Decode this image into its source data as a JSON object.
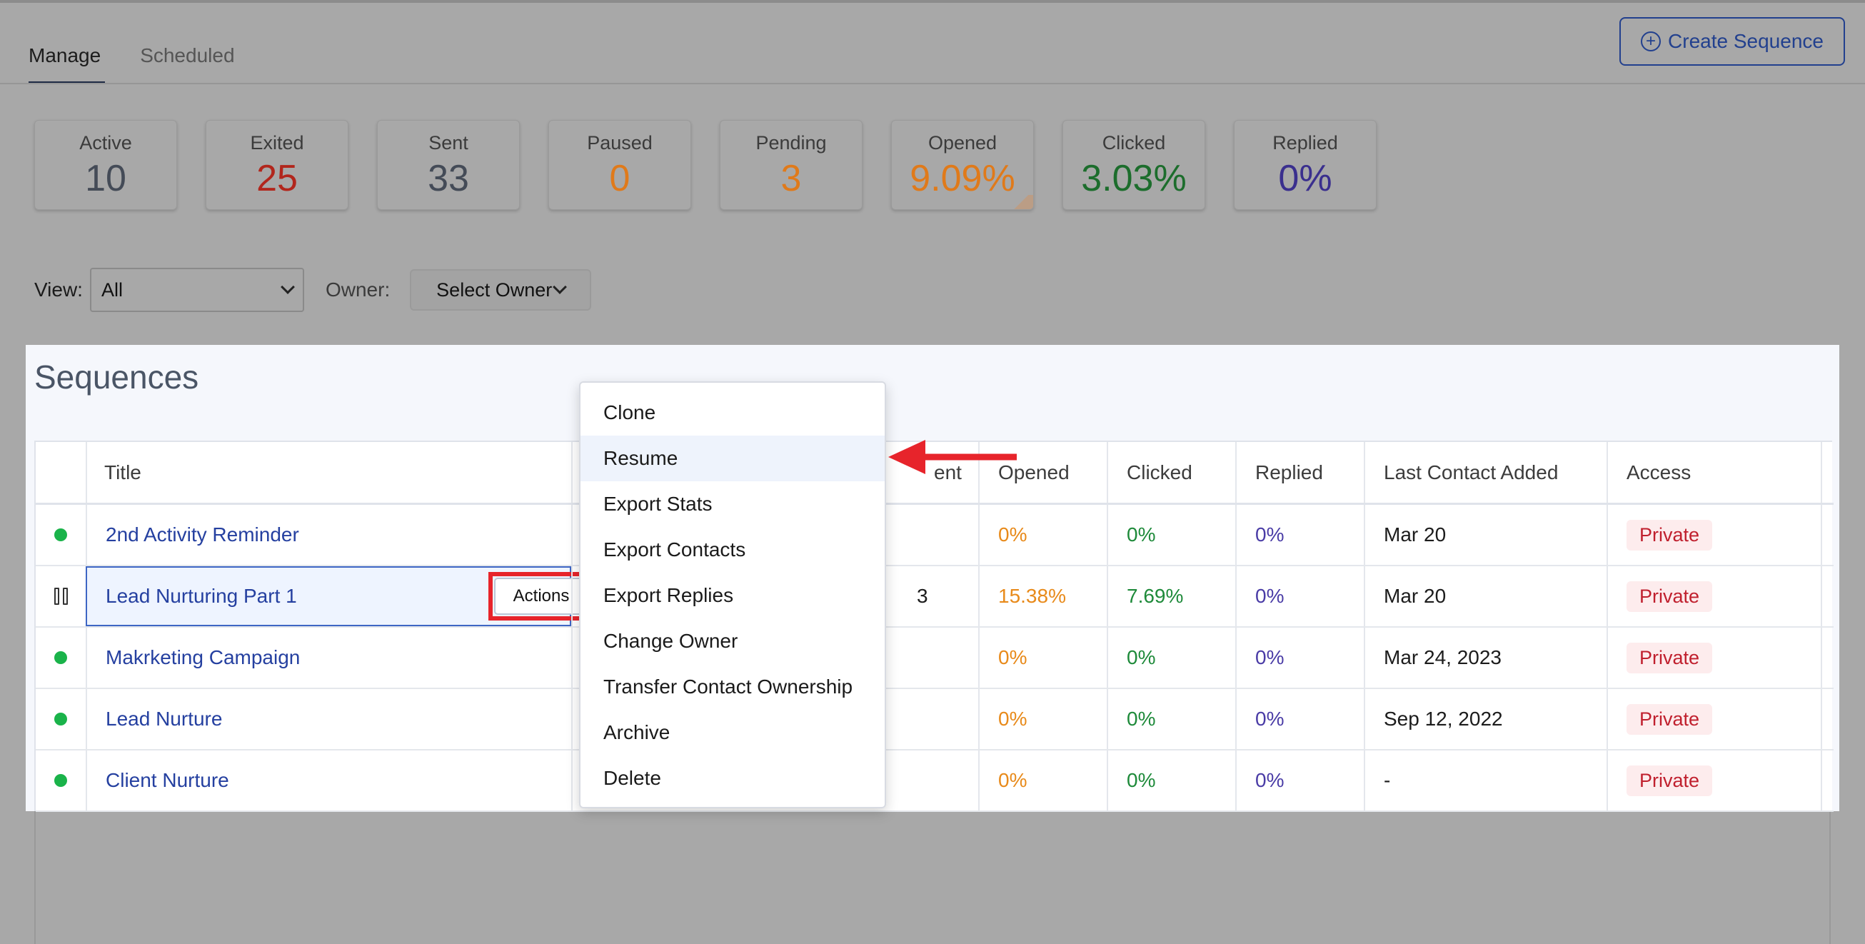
{
  "tabs": [
    {
      "label": "Manage",
      "active": true
    },
    {
      "label": "Scheduled",
      "active": false
    }
  ],
  "create_button": {
    "label": "Create Sequence",
    "icon": "plus-circle-icon"
  },
  "stats": [
    {
      "label": "Active",
      "value": "10",
      "color": "#444b57"
    },
    {
      "label": "Exited",
      "value": "25",
      "color": "#b2261c"
    },
    {
      "label": "Sent",
      "value": "33",
      "color": "#444b57"
    },
    {
      "label": "Paused",
      "value": "0",
      "color": "#e07a1a"
    },
    {
      "label": "Pending",
      "value": "3",
      "color": "#e07a1a"
    },
    {
      "label": "Opened",
      "value": "9.09%",
      "color": "#e07a1a"
    },
    {
      "label": "Clicked",
      "value": "3.03%",
      "color": "#1c6d2c"
    },
    {
      "label": "Replied",
      "value": "0%",
      "color": "#3a2f8e"
    }
  ],
  "filters": {
    "view_label": "View:",
    "view_value": "All",
    "owner_label": "Owner:",
    "owner_value": "Select Owner"
  },
  "sequences": {
    "title": "Sequences",
    "columns": {
      "title": "Title",
      "sent_partial": "ent",
      "opened": "Opened",
      "clicked": "Clicked",
      "replied": "Replied",
      "last_contact": "Last Contact Added",
      "access": "Access"
    },
    "rows": [
      {
        "status": "active",
        "title": "2nd Activity Reminder",
        "sent": "",
        "opened": "0%",
        "clicked": "0%",
        "replied": "0%",
        "last": "Mar 20",
        "access": "Private"
      },
      {
        "status": "paused",
        "title": "Lead Nurturing Part 1",
        "sent": "3",
        "opened": "15.38%",
        "clicked": "7.69%",
        "replied": "0%",
        "last": "Mar 20",
        "access": "Private"
      },
      {
        "status": "active",
        "title": "Makrketing Campaign",
        "sent": "",
        "opened": "0%",
        "clicked": "0%",
        "replied": "0%",
        "last": "Mar 24, 2023",
        "access": "Private"
      },
      {
        "status": "active",
        "title": "Lead Nurture",
        "sent": "",
        "opened": "0%",
        "clicked": "0%",
        "replied": "0%",
        "last": "Sep 12, 2022",
        "access": "Private"
      },
      {
        "status": "active",
        "title": "Client Nurture",
        "sent": "",
        "opened": "0%",
        "clicked": "0%",
        "replied": "0%",
        "last": "-",
        "access": "Private"
      }
    ],
    "actions_label": "Actions"
  },
  "menu": {
    "items": [
      "Clone",
      "Resume",
      "Export Stats",
      "Export Contacts",
      "Export Replies",
      "Change Owner",
      "Transfer Contact Ownership",
      "Archive",
      "Delete"
    ],
    "highlighted": "Resume"
  },
  "annotation": {
    "arrow_color": "#e7242b",
    "box_color": "#e7242b"
  }
}
